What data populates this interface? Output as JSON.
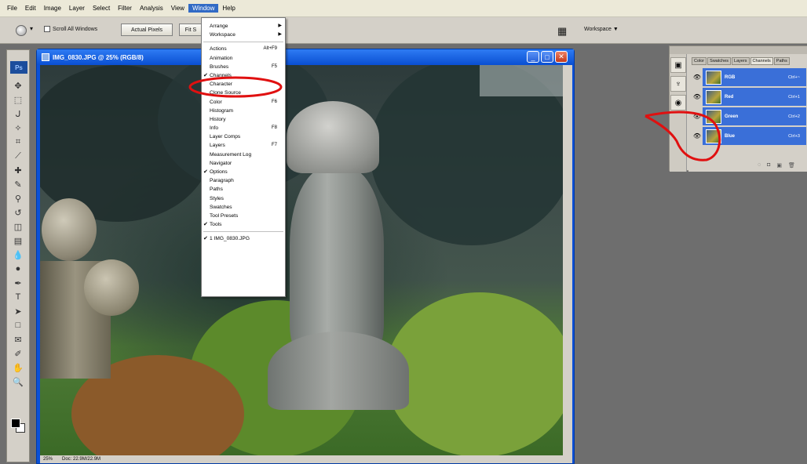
{
  "menubar": {
    "items": [
      "File",
      "Edit",
      "Image",
      "Layer",
      "Select",
      "Filter",
      "Analysis",
      "View",
      "Window",
      "Help"
    ],
    "active_index": 8
  },
  "options_bar": {
    "scroll_all_windows_label": "Scroll All Windows",
    "actual_pixels_label": "Actual Pixels",
    "fit_label": "Fit S",
    "workspace_label": "Workspace ▼"
  },
  "toolbox": {
    "logo": "Ps",
    "tool_icons": [
      "move-icon",
      "marquee-icon",
      "lasso-icon",
      "magic-wand-icon",
      "crop-icon",
      "slice-icon",
      "healing-brush-icon",
      "brush-icon",
      "clone-stamp-icon",
      "history-brush-icon",
      "eraser-icon",
      "gradient-icon",
      "blur-icon",
      "dodge-icon",
      "pen-icon",
      "type-icon",
      "path-select-icon",
      "shape-icon",
      "notes-icon",
      "eyedropper-icon",
      "hand-icon",
      "zoom-icon"
    ]
  },
  "document": {
    "title": "IMG_0830.JPG @ 25% (RGB/8)",
    "status_zoom": "25%",
    "status_doc": "Doc: 22.9M/22.9M",
    "colors": {
      "titlebar": "#0a50d8",
      "close": "#c2381b"
    }
  },
  "window_menu": {
    "items": [
      {
        "label": "Arrange",
        "shortcut": "",
        "check": false,
        "submenu": true
      },
      {
        "label": "Workspace",
        "shortcut": "",
        "check": false,
        "submenu": true
      },
      {
        "sep": true
      },
      {
        "label": "Actions",
        "shortcut": "Alt+F9",
        "check": false
      },
      {
        "label": "Animation",
        "shortcut": "",
        "check": false
      },
      {
        "label": "Brushes",
        "shortcut": "F5",
        "check": false
      },
      {
        "label": "Channels",
        "shortcut": "",
        "check": true
      },
      {
        "label": "Character",
        "shortcut": "",
        "check": false
      },
      {
        "label": "Clone Source",
        "shortcut": "",
        "check": false
      },
      {
        "label": "Color",
        "shortcut": "F6",
        "check": false
      },
      {
        "label": "Histogram",
        "shortcut": "",
        "check": false
      },
      {
        "label": "History",
        "shortcut": "",
        "check": false
      },
      {
        "label": "Info",
        "shortcut": "F8",
        "check": false
      },
      {
        "label": "Layer Comps",
        "shortcut": "",
        "check": false
      },
      {
        "label": "Layers",
        "shortcut": "F7",
        "check": false
      },
      {
        "label": "Measurement Log",
        "shortcut": "",
        "check": false
      },
      {
        "label": "Navigator",
        "shortcut": "",
        "check": false
      },
      {
        "label": "Options",
        "shortcut": "",
        "check": true
      },
      {
        "label": "Paragraph",
        "shortcut": "",
        "check": false
      },
      {
        "label": "Paths",
        "shortcut": "",
        "check": false
      },
      {
        "label": "Styles",
        "shortcut": "",
        "check": false
      },
      {
        "label": "Swatches",
        "shortcut": "",
        "check": false
      },
      {
        "label": "Tool Presets",
        "shortcut": "",
        "check": false
      },
      {
        "label": "Tools",
        "shortcut": "",
        "check": true
      },
      {
        "sep": true
      },
      {
        "label": "1 IMG_0830.JPG",
        "shortcut": "",
        "check": true
      }
    ]
  },
  "channels_panel": {
    "tabs": [
      "Color",
      "Swatches",
      "Layers",
      "Channels",
      "Paths"
    ],
    "active_tab_index": 3,
    "rows": [
      {
        "label": "RGB",
        "shortcut": "Ctrl+~"
      },
      {
        "label": "Red",
        "shortcut": "Ctrl+1"
      },
      {
        "label": "Green",
        "shortcut": "Ctrl+2"
      },
      {
        "label": "Blue",
        "shortcut": "Ctrl+3"
      }
    ],
    "footer_icons": [
      "load-selection-icon",
      "save-selection-icon",
      "new-channel-icon",
      "trash-icon"
    ]
  },
  "annotation_color": "#e01010"
}
